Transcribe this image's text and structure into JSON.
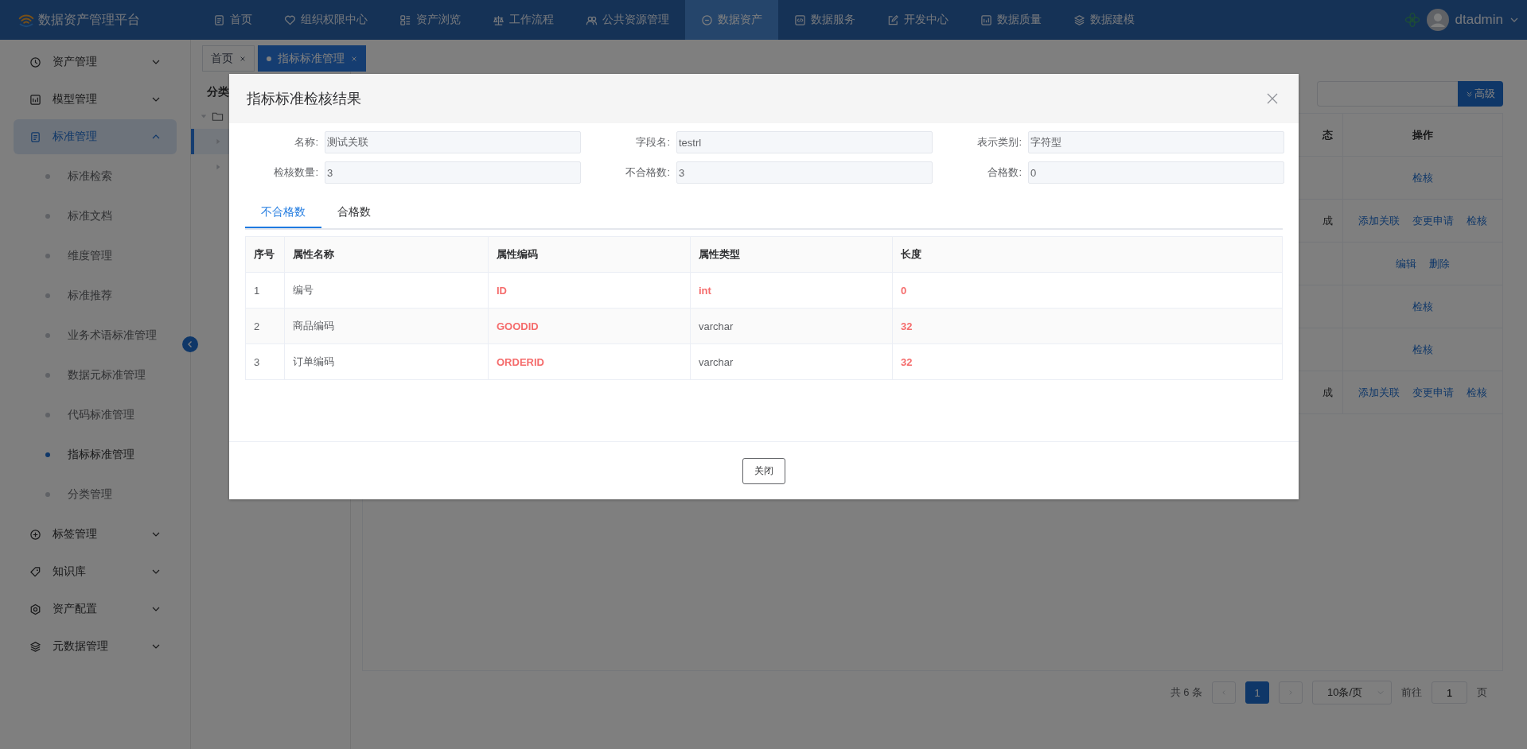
{
  "app": {
    "title": "数据资产管理平台",
    "user": "dtadmin"
  },
  "nav": [
    {
      "label": "首页",
      "selected": false
    },
    {
      "label": "组织权限中心",
      "selected": false
    },
    {
      "label": "资产浏览",
      "selected": false
    },
    {
      "label": "工作流程",
      "selected": false
    },
    {
      "label": "公共资源管理",
      "selected": false
    },
    {
      "label": "数据资产",
      "selected": true
    },
    {
      "label": "数据服务",
      "selected": false
    },
    {
      "label": "开发中心",
      "selected": false
    },
    {
      "label": "数据质量",
      "selected": false
    },
    {
      "label": "数据建模",
      "selected": false
    }
  ],
  "sidebar": [
    {
      "label": "资产管理",
      "expanded": false,
      "selected": false
    },
    {
      "label": "模型管理",
      "expanded": false,
      "selected": false
    },
    {
      "label": "标准管理",
      "expanded": true,
      "selected": true,
      "children": [
        {
          "label": "标准检索",
          "selected": false
        },
        {
          "label": "标准文档",
          "selected": false
        },
        {
          "label": "维度管理",
          "selected": false
        },
        {
          "label": "标准推荐",
          "selected": false
        },
        {
          "label": "业务术语标准管理",
          "selected": false
        },
        {
          "label": "数据元标准管理",
          "selected": false
        },
        {
          "label": "代码标准管理",
          "selected": false
        },
        {
          "label": "指标标准管理",
          "selected": true
        },
        {
          "label": "分类管理",
          "selected": false
        }
      ]
    },
    {
      "label": "标签管理",
      "expanded": false,
      "selected": false
    },
    {
      "label": "知识库",
      "expanded": false,
      "selected": false
    },
    {
      "label": "资产配置",
      "expanded": false,
      "selected": false
    },
    {
      "label": "元数据管理",
      "expanded": false,
      "selected": false
    }
  ],
  "page_tabs": [
    {
      "label": "首页",
      "selected": false
    },
    {
      "label": "指标标准管理",
      "selected": true
    }
  ],
  "tree": {
    "title": "分类"
  },
  "search": {
    "advanced_button": "高级"
  },
  "table": {
    "columns": [
      "态",
      "操作"
    ],
    "rows": [
      {
        "actions": [
          "检核"
        ]
      },
      {
        "status": "成",
        "actions": [
          "添加关联",
          "变更申请",
          "检核"
        ]
      },
      {
        "actions": [
          "编辑",
          "删除"
        ]
      },
      {
        "actions": [
          "检核"
        ]
      },
      {
        "actions": [
          "检核"
        ]
      },
      {
        "status": "成",
        "actions": [
          "添加关联",
          "变更申请",
          "检核"
        ]
      }
    ]
  },
  "pagination": {
    "total": "共 6 条",
    "current": "1",
    "page_size": "10条/页",
    "goto_label": "前往",
    "goto_value": "1",
    "page_unit": "页"
  },
  "dialog": {
    "title": "指标标准检核结果",
    "fields": [
      {
        "label": "名称:",
        "value": "测试关联"
      },
      {
        "label": "字段名:",
        "value": "testrl"
      },
      {
        "label": "表示类别:",
        "value": "字符型"
      },
      {
        "label": "检核数量:",
        "value": "3"
      },
      {
        "label": "不合格数:",
        "value": "3"
      },
      {
        "label": "合格数:",
        "value": "0"
      }
    ],
    "tabs": [
      {
        "label": "不合格数",
        "selected": true
      },
      {
        "label": "合格数",
        "selected": false
      }
    ],
    "columns": [
      "序号",
      "属性名称",
      "属性编码",
      "属性类型",
      "长度"
    ],
    "rows": [
      {
        "cells": [
          {
            "text": "1",
            "invalid": false
          },
          {
            "text": "编号",
            "invalid": false
          },
          {
            "text": "ID",
            "invalid": true
          },
          {
            "text": "int",
            "invalid": true
          },
          {
            "text": "0",
            "invalid": true
          }
        ]
      },
      {
        "cells": [
          {
            "text": "2",
            "invalid": false
          },
          {
            "text": "商品编码",
            "invalid": false
          },
          {
            "text": "GOODID",
            "invalid": true
          },
          {
            "text": "varchar",
            "invalid": false
          },
          {
            "text": "32",
            "invalid": true
          }
        ]
      },
      {
        "cells": [
          {
            "text": "3",
            "invalid": false
          },
          {
            "text": "订单编码",
            "invalid": false
          },
          {
            "text": "ORDERID",
            "invalid": true
          },
          {
            "text": "varchar",
            "invalid": false
          },
          {
            "text": "32",
            "invalid": true
          }
        ]
      }
    ],
    "close_button": "关闭"
  }
}
